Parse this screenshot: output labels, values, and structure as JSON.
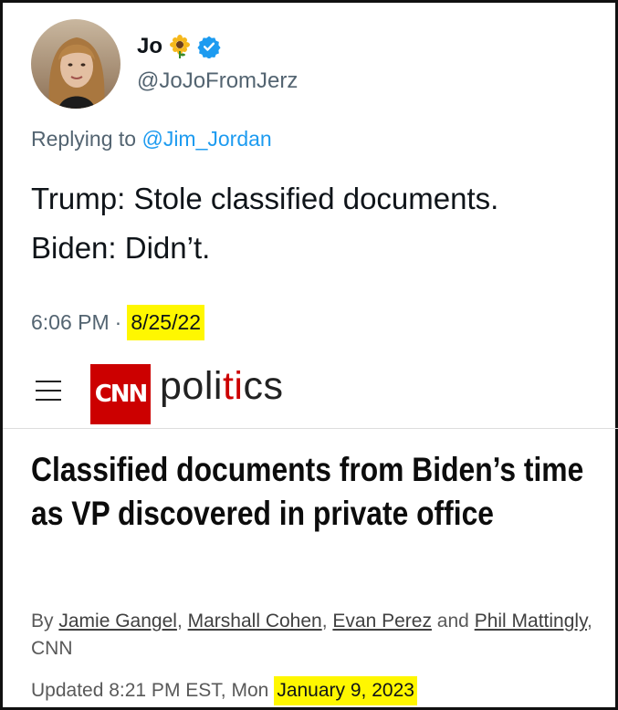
{
  "tweet": {
    "name": "Jo",
    "handle": "@JoJoFromJerz",
    "replying_prefix": "Replying to",
    "replying_to": "@Jim_Jordan",
    "text_line1": "Trump: Stole classified documents.",
    "text_line2": "Biden: Didn’t.",
    "time": "6:06 PM",
    "separator": "·",
    "date": "8/25/22"
  },
  "cnn": {
    "logo_text": "CNN",
    "section_part1": "poli",
    "section_part2": "ti",
    "section_part3": "cs",
    "headline": "Classified documents from Biden’s time as VP discovered in private office",
    "byline_prefix": "By",
    "authors": [
      "Jamie Gangel",
      "Marshall Cohen",
      "Evan Perez",
      "Phil Mattingly"
    ],
    "byline_sep1": ",",
    "byline_sep2": ",",
    "byline_and": "and",
    "byline_suffix": ", CNN",
    "updated_prefix": "Updated 8:21 PM EST, Mon",
    "updated_date": "January 9, 2023"
  },
  "colors": {
    "highlight": "#fff700",
    "twitter_blue": "#1d9bf0",
    "cnn_red": "#cc0000"
  },
  "icons": [
    "sunflower-icon",
    "verified-badge-icon",
    "hamburger-menu-icon"
  ]
}
